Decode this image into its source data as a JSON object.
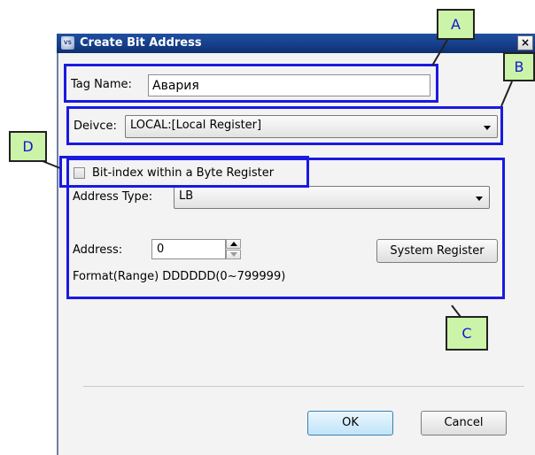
{
  "dialog": {
    "title": "Create Bit Address",
    "app_icon_text": "VS",
    "close_label": "×"
  },
  "tag_name": {
    "label": "Tag Name:",
    "value": "Авария"
  },
  "device": {
    "label": "Deivce:",
    "selected": "LOCAL:[Local Register]"
  },
  "bit_index": {
    "label": "Bit-index within a Byte Register",
    "checked": false
  },
  "address_type": {
    "label": "Address Type:",
    "selected": "LB"
  },
  "address": {
    "label": "Address:",
    "value": "0",
    "format_text": "Format(Range) DDDDDD(0~799999)",
    "system_register_label": "System Register"
  },
  "buttons": {
    "ok_label": "OK",
    "cancel_label": "Cancel"
  },
  "callouts": {
    "a": "A",
    "b": "B",
    "c": "C",
    "d": "D"
  },
  "colors": {
    "frame": "#1a1ae0",
    "callout_fill": "#ccf4a8",
    "callout_text": "#1515d8",
    "titlebar": "#163f8a"
  }
}
